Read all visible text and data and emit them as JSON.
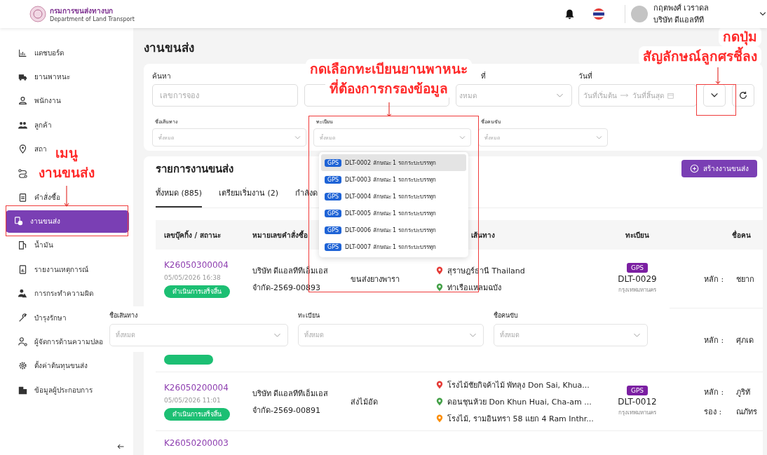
{
  "header": {
    "logo_title": "กรมการขนส่งทางบก",
    "logo_subtitle": "Department of Land Transport",
    "user_name": "กฤตพงศ์ เวราดล",
    "user_company": "บริษัท ดีแอลทีที"
  },
  "sidebar": {
    "items": [
      {
        "label": "แดชบอร์ด",
        "selected": false
      },
      {
        "label": "ยานพาหนะ",
        "selected": false
      },
      {
        "label": "พนักงาน",
        "selected": false
      },
      {
        "label": "ลูกค้า",
        "selected": false
      },
      {
        "label": "สถา",
        "selected": false
      },
      {
        "selected": false
      },
      {
        "label": "คำสั่งซื้อ",
        "selected": false
      },
      {
        "label": "งานขนส่ง",
        "selected": true
      },
      {
        "label": "น้ำมัน",
        "selected": false
      },
      {
        "label": "รายงานเหตุการณ์",
        "selected": false
      },
      {
        "label": "การกระทำความผิด",
        "selected": false
      },
      {
        "label": "บำรุงรักษา",
        "selected": false
      },
      {
        "label": "ผู้จัดการด้านความปลอ",
        "selected": false
      },
      {
        "label": "ตั้งค่าต้นทุนขนส่ง",
        "selected": false
      },
      {
        "label": "ข้อมูลผู้ประกอบการ",
        "selected": false
      }
    ]
  },
  "page_title": "งานขนส่ง",
  "filters": {
    "search": {
      "label": "ค้นหา",
      "placeholder": "เลขการจอง"
    },
    "status": {
      "label": "ที่",
      "placeholder": "งหมด"
    },
    "date": {
      "label": "วันที่",
      "start_placeholder": "วันที่เริ่มต้น",
      "end_placeholder": "วันที่สิ้นสุด"
    },
    "selects": [
      {
        "label": "ชื่อเส้นทาง",
        "placeholder": "ทั้งหมด"
      },
      {
        "label": "ทะเบียน",
        "placeholder": "ทั้งหมด"
      },
      {
        "label": "ชื่อคนขับ",
        "placeholder": "ทั้งหมด"
      }
    ]
  },
  "plate_dropdown": {
    "options": [
      {
        "badge": "GPS",
        "label": "DLT-0002 ลักษณะ 1 รถกระบะบรรทุก",
        "selected": true
      },
      {
        "badge": "GPS",
        "label": "DLT-0003 ลักษณะ 1 รถกระบะบรรทุก",
        "selected": false
      },
      {
        "badge": "GPS",
        "label": "DLT-0004 ลักษณะ 1 รถกระบะบรรทุก",
        "selected": false
      },
      {
        "badge": "GPS",
        "label": "DLT-0005 ลักษณะ 1 รถกระบะบรรทุก",
        "selected": false
      },
      {
        "badge": "GPS",
        "label": "DLT-0006 ลักษณะ 1 รถกระบะบรรทุก",
        "selected": false
      },
      {
        "badge": "GPS",
        "label": "DLT-0007 ลักษณะ 1 รถกระบะบรรทุก",
        "selected": false
      }
    ]
  },
  "jobs": {
    "title": "รายการงานขนส่ง",
    "create_button": "สร้างงานขนส่ง",
    "tabs": [
      {
        "label": "ทั้งหมด (885)",
        "selected": true
      },
      {
        "label": "เตรียมเริ่มงาน (2)",
        "selected": false
      },
      {
        "label": "กำลังด",
        "selected": false
      }
    ],
    "columns": [
      "เลขบุ๊คกิ้ง / สถานะ",
      "หมายเลขคำสั่งซื้อ",
      "เส้นทาง",
      "ทะเบียน",
      "ชื่อคน"
    ],
    "rows": [
      {
        "kind": "full",
        "booking": "K26050300004",
        "datetime": "05/05/2026 16:38",
        "status": "ดำเนินการเสร็จสิ้น",
        "order_lines": [
          "บริษัท ดีแอลทีทีเอ็มเอส",
          "จำกัด-2569-00893"
        ],
        "job_type": "ขนส่งยางพารา",
        "stops": [
          {
            "text": "สุราษฎร์ธานี Thailand",
            "color": "#e53935"
          },
          {
            "text": "ท่าเรือแหลมฉบัง",
            "color": "#43a047"
          }
        ],
        "plate_badge": "GPS",
        "plate": "DLT-0029",
        "province": "กรุงเทพมหานคร",
        "drivers": [
          {
            "role": "หลัก :",
            "name": "ชยาก"
          }
        ]
      },
      {
        "kind": "covered",
        "drivers": [
          {
            "role": "หลัก :",
            "name": "ศุภเด"
          }
        ]
      },
      {
        "kind": "full",
        "booking": "K26050200004",
        "datetime": "05/05/2026 11:01",
        "status": "ดำเนินการเสร็จสิ้น",
        "order_lines": [
          "บริษัท ดีแอลทีทีเอ็มเอส",
          "จำกัด-2569-00891"
        ],
        "job_type": "ส่งไม้อัด",
        "stops": [
          {
            "text": "โรงไม้ชัยกิจค้าไม้ พัทลุง Don Sai, Khua...",
            "color": "#e53935"
          },
          {
            "text": "ดอนชุนห้วย Don Khun Huai, Cha-am ...",
            "color": "#43a047"
          },
          {
            "text": "โรงไม้, รามอินทรา 58 แยก 4 Ram Inthr...",
            "color": "#fb8c00"
          }
        ],
        "plate_badge": "GPS",
        "plate": "DLT-0012",
        "province": "กรุงเทพมหานคร",
        "drivers": [
          {
            "role": "หลัก :",
            "name": "ภูริทั"
          },
          {
            "role": "รอง :",
            "name": "ณภัทร"
          }
        ]
      },
      {
        "kind": "partial",
        "booking": "K26050200003"
      }
    ]
  },
  "overlay_filters": {
    "selects": [
      {
        "label": "ชื่อเส้นทาง",
        "placeholder": "ทั้งหมด"
      },
      {
        "label": "ทะเบียน",
        "placeholder": "ทั้งหมด"
      },
      {
        "label": "ชื่อคนขับ",
        "placeholder": "ทั้งหมด"
      }
    ]
  },
  "annotations": [
    {
      "kind": "menu",
      "lines": [
        "เมนู",
        "งานขนส่ง"
      ]
    },
    {
      "kind": "plate",
      "lines": [
        "กดเลือกทะเบียนยานพาหนะ",
        "ที่ต้องการกรองข้อมูล"
      ]
    },
    {
      "kind": "expand",
      "lines": [
        "กดปุ่ม",
        "สัญลักษณ์ลูกศรชี้ลง"
      ]
    }
  ]
}
